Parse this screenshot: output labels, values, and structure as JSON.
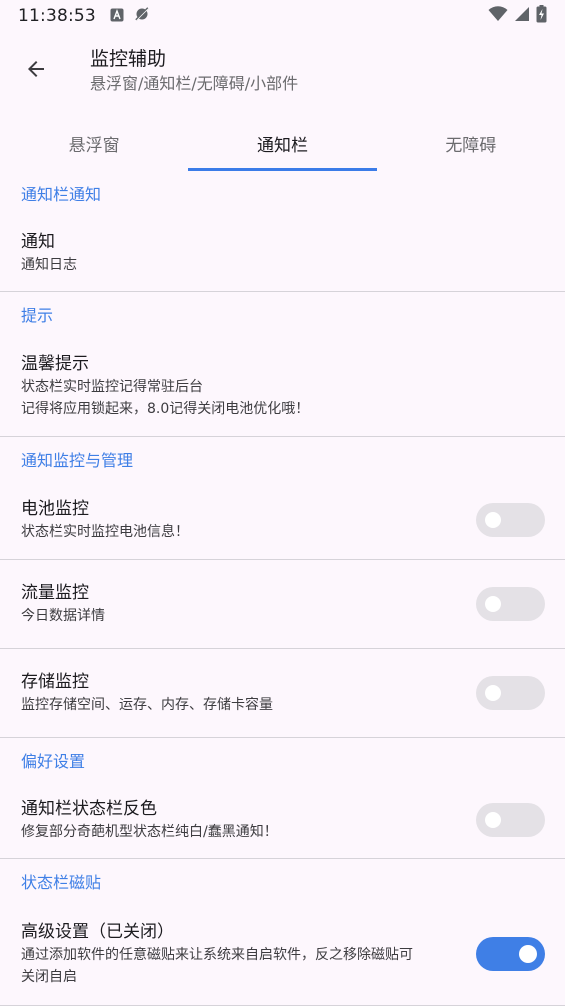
{
  "status_bar": {
    "time": "11:38:53"
  },
  "app_bar": {
    "title": "监控辅助",
    "subtitle": "悬浮窗/通知栏/无障碍/小部件"
  },
  "tabs": [
    {
      "label": "悬浮窗",
      "active": false
    },
    {
      "label": "通知栏",
      "active": true
    },
    {
      "label": "无障碍",
      "active": false
    }
  ],
  "sections": {
    "notification": {
      "header": "通知栏通知",
      "item_title": "通知",
      "item_summary": "通知日志"
    },
    "tips": {
      "header": "提示",
      "item_title": "温馨提示",
      "item_summary_line1": "状态栏实时监控记得常驻后台",
      "item_summary_line2": "记得将应用锁起来，8.0记得关闭电池优化哦！"
    },
    "monitor": {
      "header": "通知监控与管理",
      "battery_title": "电池监控",
      "battery_summary": "状态栏实时监控电池信息！",
      "battery_on": false,
      "traffic_title": "流量监控",
      "traffic_summary": "今日数据详情",
      "traffic_on": false,
      "storage_title": "存储监控",
      "storage_summary": "监控存储空间、运存、内存、存储卡容量",
      "storage_on": false
    },
    "preference": {
      "header": "偏好设置",
      "invert_title": "通知栏状态栏反色",
      "invert_summary": "修复部分奇葩机型状态栏纯白/蠢黑通知！",
      "invert_on": false
    },
    "tiles": {
      "header": "状态栏磁贴",
      "advanced_title": "高级设置（已关闭）",
      "advanced_summary_line1": "通过添加软件的任意磁贴来让系统来自启软件，反之移除磁贴可",
      "advanced_summary_line2": "关闭自启",
      "advanced_on": true
    }
  },
  "colors": {
    "accent": "#3f7fe6",
    "background": "#fdf7fd",
    "switch_off": "#e4e1e6"
  }
}
